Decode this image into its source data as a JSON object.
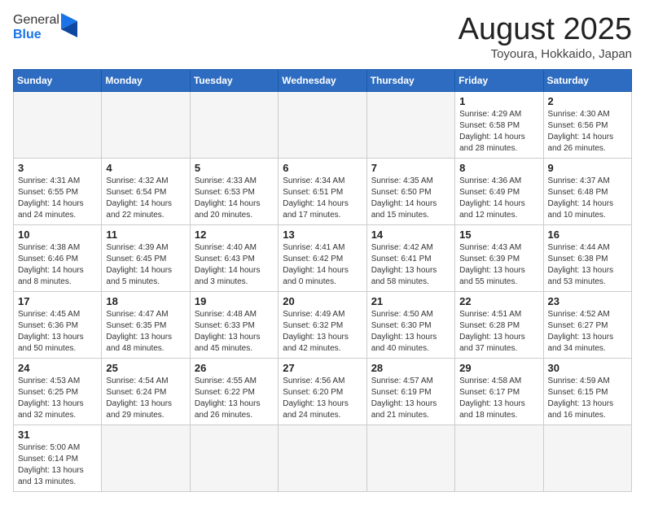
{
  "logo": {
    "text_general": "General",
    "text_blue": "Blue"
  },
  "title": "August 2025",
  "location": "Toyoura, Hokkaido, Japan",
  "days_of_week": [
    "Sunday",
    "Monday",
    "Tuesday",
    "Wednesday",
    "Thursday",
    "Friday",
    "Saturday"
  ],
  "weeks": [
    [
      {
        "day": "",
        "info": ""
      },
      {
        "day": "",
        "info": ""
      },
      {
        "day": "",
        "info": ""
      },
      {
        "day": "",
        "info": ""
      },
      {
        "day": "",
        "info": ""
      },
      {
        "day": "1",
        "info": "Sunrise: 4:29 AM\nSunset: 6:58 PM\nDaylight: 14 hours and 28 minutes."
      },
      {
        "day": "2",
        "info": "Sunrise: 4:30 AM\nSunset: 6:56 PM\nDaylight: 14 hours and 26 minutes."
      }
    ],
    [
      {
        "day": "3",
        "info": "Sunrise: 4:31 AM\nSunset: 6:55 PM\nDaylight: 14 hours and 24 minutes."
      },
      {
        "day": "4",
        "info": "Sunrise: 4:32 AM\nSunset: 6:54 PM\nDaylight: 14 hours and 22 minutes."
      },
      {
        "day": "5",
        "info": "Sunrise: 4:33 AM\nSunset: 6:53 PM\nDaylight: 14 hours and 20 minutes."
      },
      {
        "day": "6",
        "info": "Sunrise: 4:34 AM\nSunset: 6:51 PM\nDaylight: 14 hours and 17 minutes."
      },
      {
        "day": "7",
        "info": "Sunrise: 4:35 AM\nSunset: 6:50 PM\nDaylight: 14 hours and 15 minutes."
      },
      {
        "day": "8",
        "info": "Sunrise: 4:36 AM\nSunset: 6:49 PM\nDaylight: 14 hours and 12 minutes."
      },
      {
        "day": "9",
        "info": "Sunrise: 4:37 AM\nSunset: 6:48 PM\nDaylight: 14 hours and 10 minutes."
      }
    ],
    [
      {
        "day": "10",
        "info": "Sunrise: 4:38 AM\nSunset: 6:46 PM\nDaylight: 14 hours and 8 minutes."
      },
      {
        "day": "11",
        "info": "Sunrise: 4:39 AM\nSunset: 6:45 PM\nDaylight: 14 hours and 5 minutes."
      },
      {
        "day": "12",
        "info": "Sunrise: 4:40 AM\nSunset: 6:43 PM\nDaylight: 14 hours and 3 minutes."
      },
      {
        "day": "13",
        "info": "Sunrise: 4:41 AM\nSunset: 6:42 PM\nDaylight: 14 hours and 0 minutes."
      },
      {
        "day": "14",
        "info": "Sunrise: 4:42 AM\nSunset: 6:41 PM\nDaylight: 13 hours and 58 minutes."
      },
      {
        "day": "15",
        "info": "Sunrise: 4:43 AM\nSunset: 6:39 PM\nDaylight: 13 hours and 55 minutes."
      },
      {
        "day": "16",
        "info": "Sunrise: 4:44 AM\nSunset: 6:38 PM\nDaylight: 13 hours and 53 minutes."
      }
    ],
    [
      {
        "day": "17",
        "info": "Sunrise: 4:45 AM\nSunset: 6:36 PM\nDaylight: 13 hours and 50 minutes."
      },
      {
        "day": "18",
        "info": "Sunrise: 4:47 AM\nSunset: 6:35 PM\nDaylight: 13 hours and 48 minutes."
      },
      {
        "day": "19",
        "info": "Sunrise: 4:48 AM\nSunset: 6:33 PM\nDaylight: 13 hours and 45 minutes."
      },
      {
        "day": "20",
        "info": "Sunrise: 4:49 AM\nSunset: 6:32 PM\nDaylight: 13 hours and 42 minutes."
      },
      {
        "day": "21",
        "info": "Sunrise: 4:50 AM\nSunset: 6:30 PM\nDaylight: 13 hours and 40 minutes."
      },
      {
        "day": "22",
        "info": "Sunrise: 4:51 AM\nSunset: 6:28 PM\nDaylight: 13 hours and 37 minutes."
      },
      {
        "day": "23",
        "info": "Sunrise: 4:52 AM\nSunset: 6:27 PM\nDaylight: 13 hours and 34 minutes."
      }
    ],
    [
      {
        "day": "24",
        "info": "Sunrise: 4:53 AM\nSunset: 6:25 PM\nDaylight: 13 hours and 32 minutes."
      },
      {
        "day": "25",
        "info": "Sunrise: 4:54 AM\nSunset: 6:24 PM\nDaylight: 13 hours and 29 minutes."
      },
      {
        "day": "26",
        "info": "Sunrise: 4:55 AM\nSunset: 6:22 PM\nDaylight: 13 hours and 26 minutes."
      },
      {
        "day": "27",
        "info": "Sunrise: 4:56 AM\nSunset: 6:20 PM\nDaylight: 13 hours and 24 minutes."
      },
      {
        "day": "28",
        "info": "Sunrise: 4:57 AM\nSunset: 6:19 PM\nDaylight: 13 hours and 21 minutes."
      },
      {
        "day": "29",
        "info": "Sunrise: 4:58 AM\nSunset: 6:17 PM\nDaylight: 13 hours and 18 minutes."
      },
      {
        "day": "30",
        "info": "Sunrise: 4:59 AM\nSunset: 6:15 PM\nDaylight: 13 hours and 16 minutes."
      }
    ],
    [
      {
        "day": "31",
        "info": "Sunrise: 5:00 AM\nSunset: 6:14 PM\nDaylight: 13 hours and 13 minutes."
      },
      {
        "day": "",
        "info": ""
      },
      {
        "day": "",
        "info": ""
      },
      {
        "day": "",
        "info": ""
      },
      {
        "day": "",
        "info": ""
      },
      {
        "day": "",
        "info": ""
      },
      {
        "day": "",
        "info": ""
      }
    ]
  ]
}
